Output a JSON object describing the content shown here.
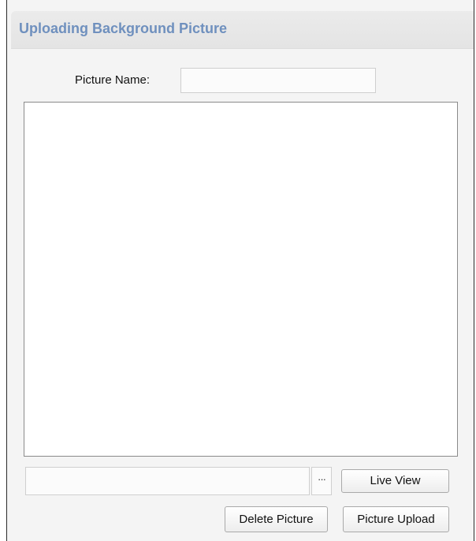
{
  "header": {
    "title": "Uploading Background Picture"
  },
  "picture_name": {
    "label": "Picture Name:",
    "value": ""
  },
  "file_path": {
    "value": ""
  },
  "buttons": {
    "browse_label": "···",
    "live_view_label": "Live View",
    "delete_label": "Delete Picture",
    "upload_label": "Picture Upload"
  },
  "colors": {
    "title": "#6f90be",
    "panel_background": "#f4f4f4",
    "header_background": "#e6e6e6"
  }
}
